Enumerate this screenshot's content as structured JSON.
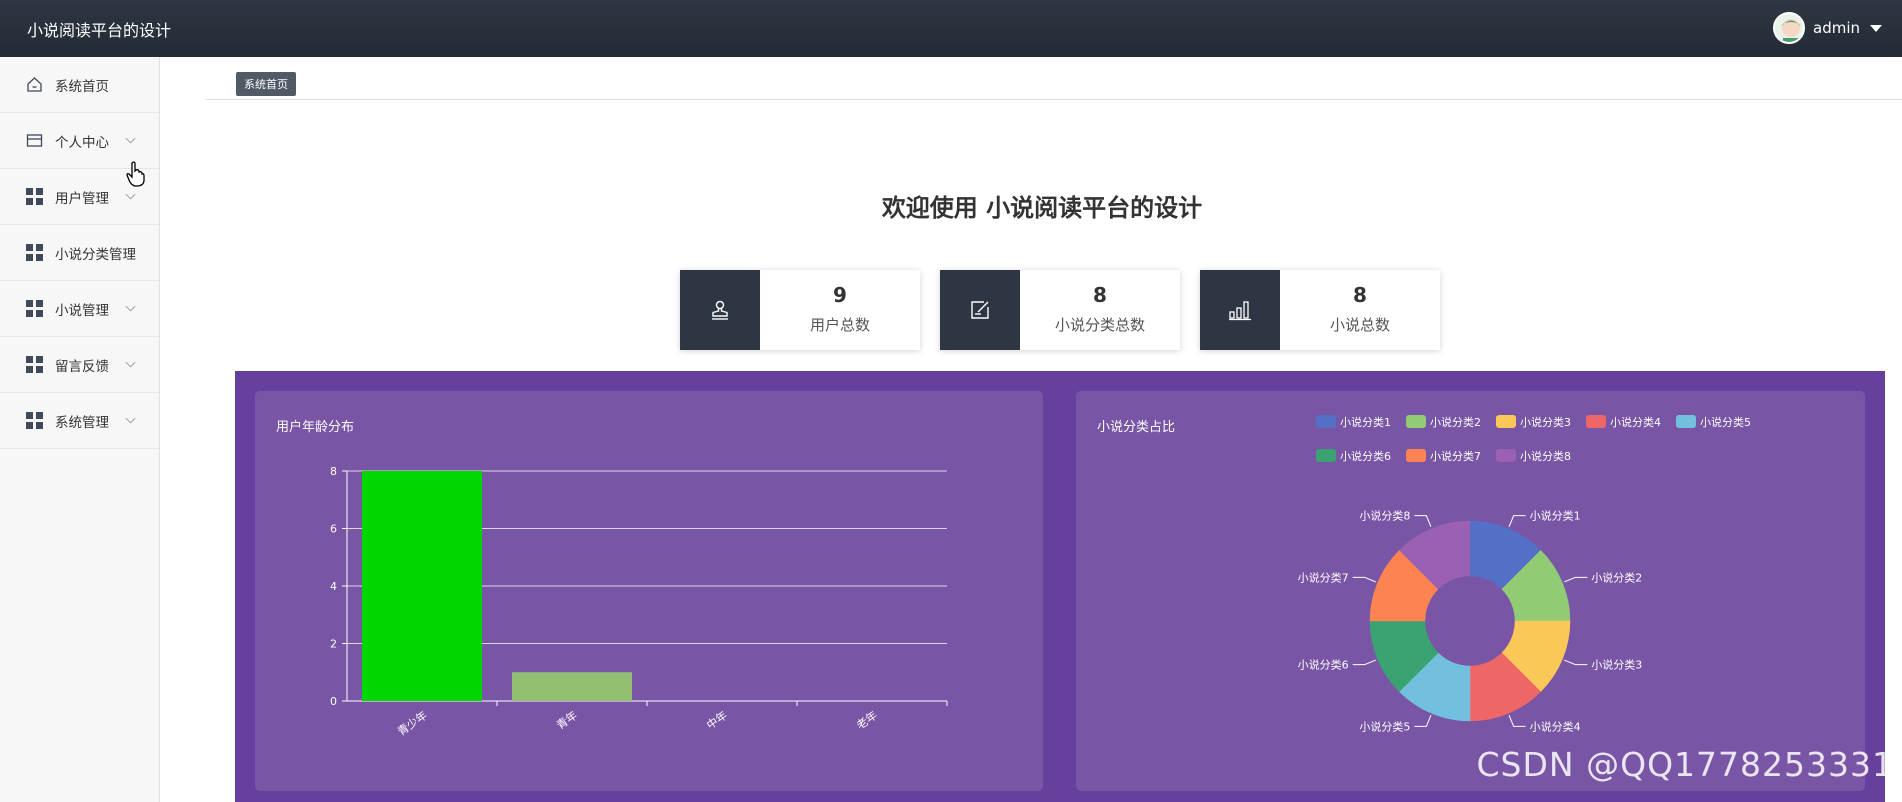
{
  "header": {
    "app_title": "小说阅读平台的设计",
    "user_name": "admin"
  },
  "sidebar": {
    "items": [
      {
        "label": "系统首页",
        "icon": "home-icon",
        "has_submenu": false
      },
      {
        "label": "个人中心",
        "icon": "card-icon",
        "has_submenu": true
      },
      {
        "label": "用户管理",
        "icon": "grid-icon",
        "has_submenu": true
      },
      {
        "label": "小说分类管理",
        "icon": "grid-icon",
        "has_submenu": false
      },
      {
        "label": "小说管理",
        "icon": "grid-icon",
        "has_submenu": true
      },
      {
        "label": "留言反馈",
        "icon": "grid-icon",
        "has_submenu": true
      },
      {
        "label": "系统管理",
        "icon": "grid-icon",
        "has_submenu": true
      }
    ]
  },
  "breadcrumb": {
    "current": "系统首页"
  },
  "welcome_text": "欢迎使用 小说阅读平台的设计",
  "stats": [
    {
      "value": "9",
      "label": "用户总数",
      "icon": "stamp-icon"
    },
    {
      "value": "8",
      "label": "小说分类总数",
      "icon": "edit-icon"
    },
    {
      "value": "8",
      "label": "小说总数",
      "icon": "bar-chart-icon"
    }
  ],
  "colors": {
    "topbar": "#2d3642",
    "panel": "#673f9c",
    "card": "#7955a6",
    "bar_primary": "#00d600",
    "bar_secondary": "#91c073"
  },
  "chart_data": [
    {
      "type": "bar",
      "title": "用户年龄分布",
      "categories": [
        "青少年",
        "青年",
        "中年",
        "老年"
      ],
      "values": [
        8,
        1,
        0,
        0
      ],
      "ylim": [
        0,
        8
      ],
      "yticks": [
        0,
        2,
        4,
        6,
        8
      ],
      "colors": [
        "#00d600",
        "#91c073",
        "#91c073",
        "#91c073"
      ],
      "grid": true
    },
    {
      "type": "pie",
      "title": "小说分类占比",
      "legend_position": "top-right",
      "donut": true,
      "labels": [
        "小说分类1",
        "小说分类2",
        "小说分类3",
        "小说分类4",
        "小说分类5",
        "小说分类6",
        "小说分类7",
        "小说分类8"
      ],
      "values": [
        1,
        1,
        1,
        1,
        1,
        1,
        1,
        1
      ],
      "colors": [
        "#5470c6",
        "#91cc75",
        "#fac858",
        "#ee6666",
        "#73c0de",
        "#3ba272",
        "#fc8452",
        "#9a60b4"
      ]
    }
  ],
  "watermark": "CSDN @QQ1778253331"
}
